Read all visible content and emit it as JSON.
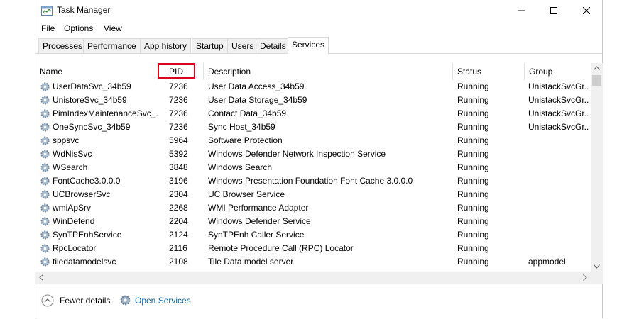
{
  "window": {
    "title": "Task Manager"
  },
  "menu": [
    "File",
    "Options",
    "View"
  ],
  "tabs": [
    "Processes",
    "Performance",
    "App history",
    "Startup",
    "Users",
    "Details",
    "Services"
  ],
  "columns": [
    "Name",
    "PID",
    "Description",
    "Status",
    "Group"
  ],
  "rows": [
    [
      "UserDataSvc_34b59",
      "7236",
      "User Data Access_34b59",
      "Running",
      "UnistackSvcGr..."
    ],
    [
      "UnistoreSvc_34b59",
      "7236",
      "User Data Storage_34b59",
      "Running",
      "UnistackSvcGr..."
    ],
    [
      "PimIndexMaintenanceSvc_...",
      "7236",
      "Contact Data_34b59",
      "Running",
      "UnistackSvcGr..."
    ],
    [
      "OneSyncSvc_34b59",
      "7236",
      "Sync Host_34b59",
      "Running",
      "UnistackSvcGr..."
    ],
    [
      "sppsvc",
      "5964",
      "Software Protection",
      "Running",
      ""
    ],
    [
      "WdNisSvc",
      "5392",
      "Windows Defender Network Inspection Service",
      "Running",
      ""
    ],
    [
      "WSearch",
      "3848",
      "Windows Search",
      "Running",
      ""
    ],
    [
      "FontCache3.0.0.0",
      "3196",
      "Windows Presentation Foundation Font Cache 3.0.0.0",
      "Running",
      ""
    ],
    [
      "UCBrowserSvc",
      "2304",
      "UC Browser Service",
      "Running",
      ""
    ],
    [
      "wmiApSrv",
      "2268",
      "WMI Performance Adapter",
      "Running",
      ""
    ],
    [
      "WinDefend",
      "2204",
      "Windows Defender Service",
      "Running",
      ""
    ],
    [
      "SynTPEnhService",
      "2124",
      "SynTPEnh Caller Service",
      "Running",
      ""
    ],
    [
      "RpcLocator",
      "2116",
      "Remote Procedure Call (RPC) Locator",
      "Running",
      ""
    ],
    [
      "tiledatamodelsvc",
      "2108",
      "Tile Data model server",
      "Running",
      "appmodel"
    ]
  ],
  "footer": {
    "fewer_details": "Fewer details",
    "open_services": "Open Services"
  },
  "colors": {
    "link": "#0063b1",
    "highlight": "#e0001a"
  }
}
